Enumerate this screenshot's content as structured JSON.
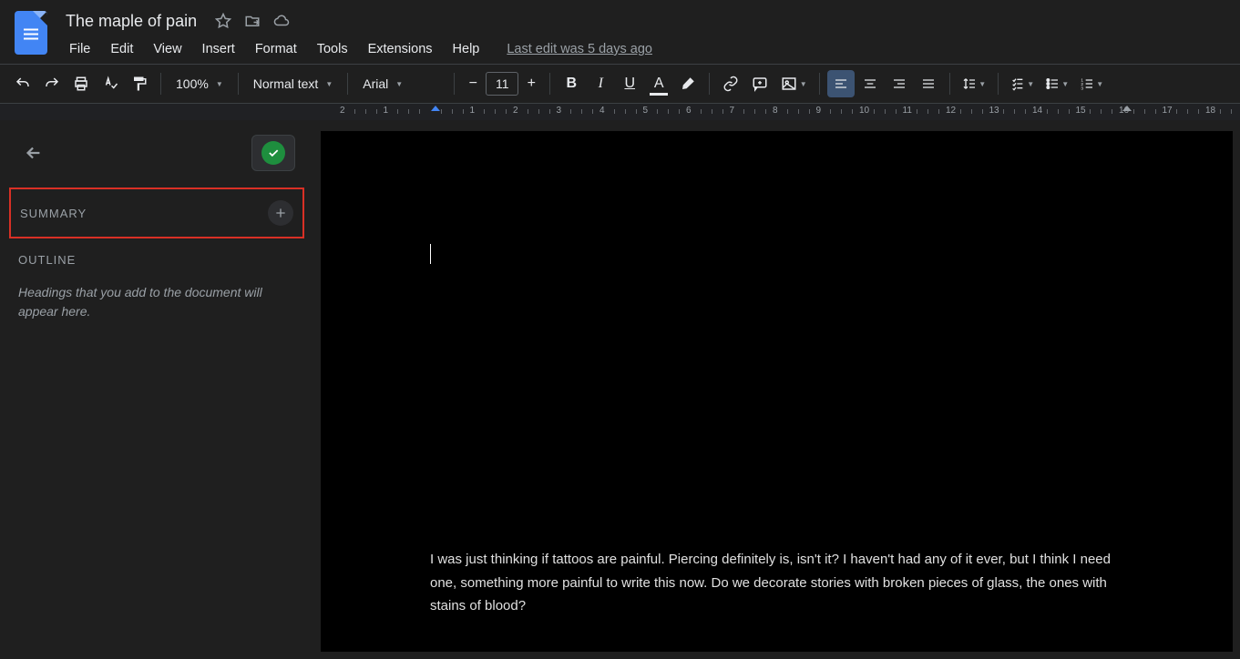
{
  "header": {
    "title": "The maple of pain",
    "last_edit": "Last edit was 5 days ago"
  },
  "menu": {
    "file": "File",
    "edit": "Edit",
    "view": "View",
    "insert": "Insert",
    "format": "Format",
    "tools": "Tools",
    "extensions": "Extensions",
    "help": "Help"
  },
  "toolbar": {
    "zoom": "100%",
    "style": "Normal text",
    "font": "Arial",
    "font_size": "11"
  },
  "ruler": {
    "marks": [
      "2",
      "1",
      "",
      "1",
      "2",
      "3",
      "4",
      "5",
      "6",
      "7",
      "8",
      "9",
      "10",
      "11",
      "12",
      "13",
      "14",
      "15",
      "16",
      "17",
      "18"
    ]
  },
  "sidebar": {
    "summary_label": "SUMMARY",
    "outline_label": "OUTLINE",
    "outline_hint": "Headings that you add to the document will appear here."
  },
  "document": {
    "body": "I was just thinking if tattoos are painful. Piercing definitely is, isn't it? I haven't had any of it ever, but I think I need one, something more painful to write this now. Do we decorate stories with broken pieces of glass, the ones with stains of blood?"
  }
}
